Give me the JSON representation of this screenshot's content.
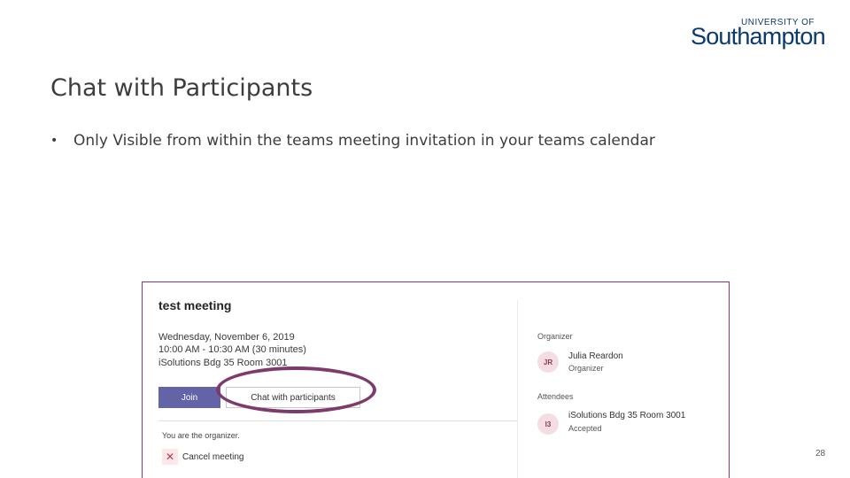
{
  "logo": {
    "top": "UNIVERSITY OF",
    "name": "Southampton"
  },
  "slide": {
    "title": "Chat with Participants",
    "bullet_marker": "•",
    "bullet": "Only Visible from within the teams meeting invitation in your teams calendar",
    "page_number": "28"
  },
  "meeting": {
    "title": "test meeting",
    "date": "Wednesday, November 6, 2019",
    "time": "10:00 AM - 10:30 AM (30 minutes)",
    "location": "iSolutions Bdg 35 Room 3001",
    "join_label": "Join",
    "chat_label": "Chat with participants",
    "organizer_note": "You are the organizer.",
    "cancel_icon": "✕",
    "cancel_label": "Cancel meeting",
    "organizer_heading": "Organizer",
    "organizer": {
      "initials": "JR",
      "name": "Julia Reardon",
      "role": "Organizer"
    },
    "attendees_heading": "Attendees",
    "attendee": {
      "initials": "I3",
      "name": "iSolutions Bdg 35 Room 3001",
      "status": "Accepted"
    }
  },
  "colors": {
    "accent": "#6264a7",
    "highlight": "#7d3a6b",
    "brand": "#0b3a6e",
    "frame": "#8b3a6e"
  }
}
